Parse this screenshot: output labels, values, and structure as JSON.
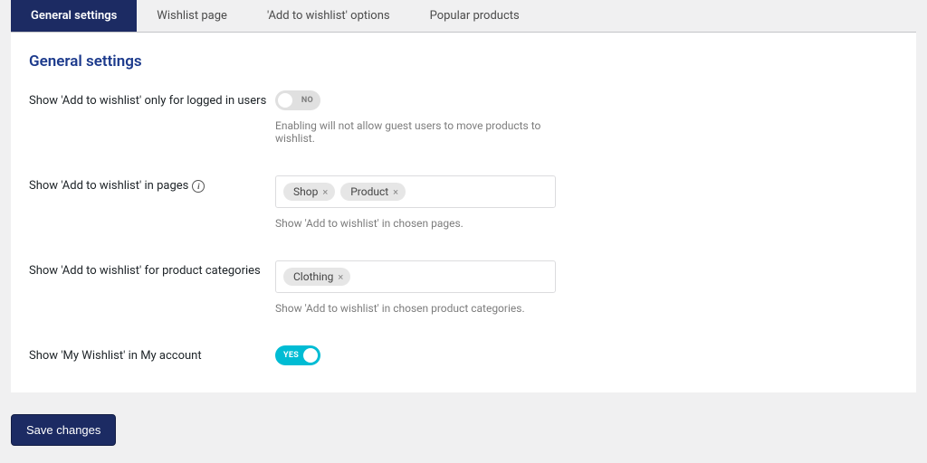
{
  "tabs": {
    "t0": "General settings",
    "t1": "Wishlist page",
    "t2": "'Add to wishlist' options",
    "t3": "Popular products"
  },
  "panel_title": "General settings",
  "rows": {
    "logged_in": {
      "label": "Show 'Add to wishlist' only for logged in users",
      "toggle_text": "NO",
      "help": "Enabling will not allow guest users to move products to wishlist."
    },
    "pages": {
      "label": "Show 'Add to wishlist' in pages",
      "tags": {
        "tag0": "Shop",
        "tag1": "Product"
      },
      "help": "Show 'Add to wishlist' in chosen pages."
    },
    "categories": {
      "label": "Show 'Add to wishlist' for product categories",
      "tags": {
        "tag0": "Clothing"
      },
      "help": "Show 'Add to wishlist' in chosen product categories."
    },
    "my_account": {
      "label": "Show 'My Wishlist' in My account",
      "toggle_text": "YES"
    }
  },
  "save_label": "Save changes"
}
